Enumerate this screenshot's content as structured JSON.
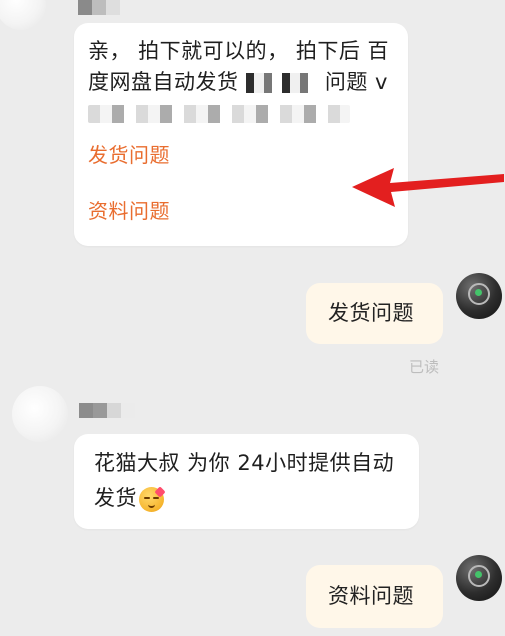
{
  "messages": [
    {
      "from": "seller",
      "line1": "亲， 拍下就可以的， 拍下后 百",
      "line2_a": "度网盘自动发货",
      "line2_b": "问题 v",
      "links": [
        "发货问题",
        "资料问题"
      ]
    },
    {
      "from": "buyer",
      "text": "发货问题",
      "status": "已读"
    },
    {
      "from": "seller",
      "line1": "花猫大叔 为你 24小时提供自动",
      "line2": "发货",
      "emoji": "smiling-face-with-heart-emoji"
    },
    {
      "from": "buyer",
      "text": "资料问题"
    }
  ],
  "annotation": {
    "arrow_color": "#e31f1f"
  },
  "colors": {
    "background": "#ececec",
    "seller_bubble": "#ffffff",
    "buyer_bubble": "#fff7e9",
    "link": "#e96d2f",
    "status_text": "#bdbdbd"
  }
}
